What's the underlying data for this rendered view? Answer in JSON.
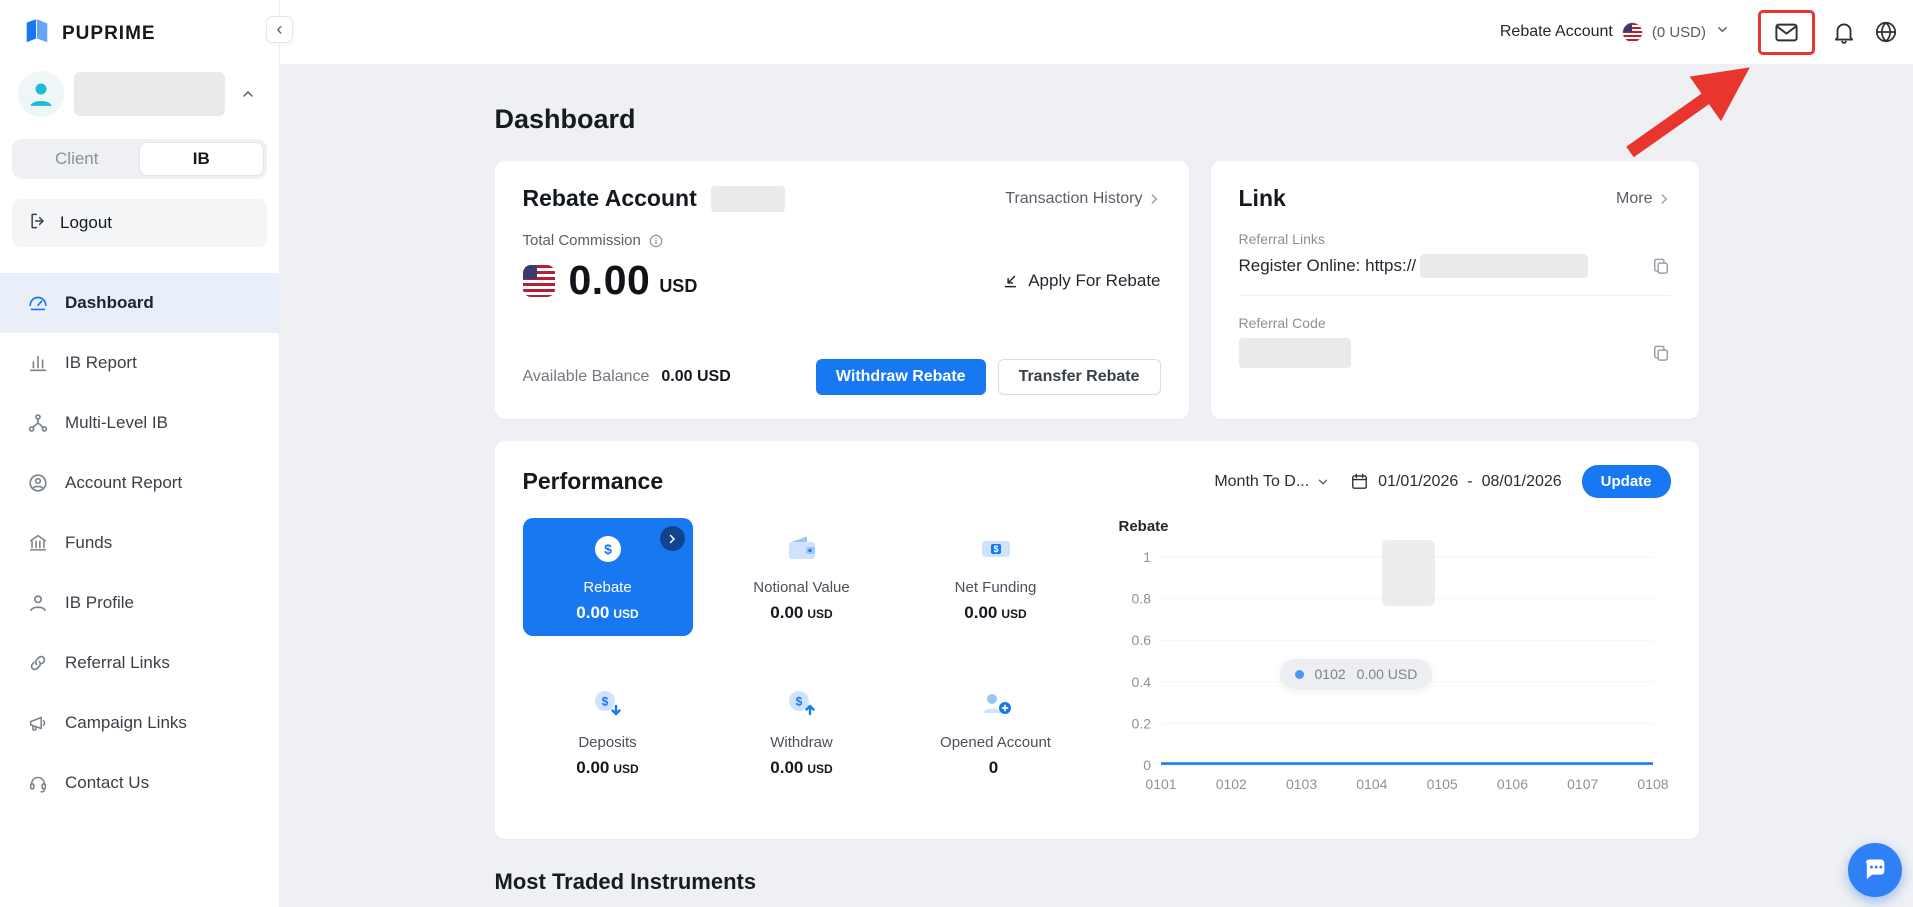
{
  "brand": {
    "name": "PUPRIME"
  },
  "colors": {
    "accent": "#1778F2",
    "annotation": "#E8352E"
  },
  "topbar": {
    "account_label": "Rebate Account",
    "balance": "(0 USD)",
    "icons": [
      "us-flag-icon",
      "chevron-down-icon",
      "mail-icon",
      "bell-icon",
      "globe-icon"
    ]
  },
  "sidebar": {
    "collapse_icon": "‹",
    "toggle": {
      "options": [
        "Client",
        "IB"
      ],
      "selected": "IB"
    },
    "logout_label": "Logout",
    "items": [
      {
        "label": "Dashboard",
        "active": true
      },
      {
        "label": "IB Report",
        "active": false
      },
      {
        "label": "Multi-Level IB",
        "active": false
      },
      {
        "label": "Account Report",
        "active": false
      },
      {
        "label": "Funds",
        "active": false
      },
      {
        "label": "IB Profile",
        "active": false
      },
      {
        "label": "Referral Links",
        "active": false
      },
      {
        "label": "Campaign Links",
        "active": false
      },
      {
        "label": "Contact Us",
        "active": false
      }
    ]
  },
  "page": {
    "title": "Dashboard",
    "most_traded_title": "Most Traded Instruments"
  },
  "rebate_card": {
    "title": "Rebate Account",
    "transaction_history": "Transaction History",
    "total_commission_label": "Total Commission",
    "amount": "0.00",
    "currency": "USD",
    "apply_for_rebate": "Apply For Rebate",
    "available_balance_label": "Available Balance",
    "available_balance_value": "0.00 USD",
    "withdraw_button": "Withdraw Rebate",
    "transfer_button": "Transfer Rebate"
  },
  "link_card": {
    "title": "Link",
    "more": "More",
    "referral_links_label": "Referral Links",
    "register_online": "Register Online: https://",
    "referral_code_label": "Referral Code"
  },
  "performance": {
    "title": "Performance",
    "period_dropdown": "Month To D...",
    "date_from": "01/01/2026",
    "date_separator": "-",
    "date_to": "08/01/2026",
    "update_button": "Update",
    "tiles": [
      {
        "label": "Rebate",
        "value": "0.00",
        "unit": "USD",
        "active": true
      },
      {
        "label": "Notional Value",
        "value": "0.00",
        "unit": "USD",
        "active": false
      },
      {
        "label": "Net Funding",
        "value": "0.00",
        "unit": "USD",
        "active": false
      },
      {
        "label": "Deposits",
        "value": "0.00",
        "unit": "USD",
        "active": false
      },
      {
        "label": "Withdraw",
        "value": "0.00",
        "unit": "USD",
        "active": false
      },
      {
        "label": "Opened Account",
        "value": "0",
        "unit": "",
        "active": false
      }
    ]
  },
  "chart_data": {
    "type": "line",
    "title": "Rebate",
    "x": [
      "0101",
      "0102",
      "0103",
      "0104",
      "0105",
      "0106",
      "0107",
      "0108"
    ],
    "series": [
      {
        "name": "Rebate",
        "values": [
          0,
          0,
          0,
          0,
          0,
          0,
          0,
          0
        ]
      }
    ],
    "ylim": [
      0,
      1
    ],
    "yticks": [
      0,
      0.2,
      0.4,
      0.6,
      0.8,
      1
    ],
    "grid": "horizontal-light",
    "legend_position": "none",
    "line_color": "#1778F2",
    "tooltip": {
      "label": "0102",
      "value": "0.00 USD"
    }
  }
}
